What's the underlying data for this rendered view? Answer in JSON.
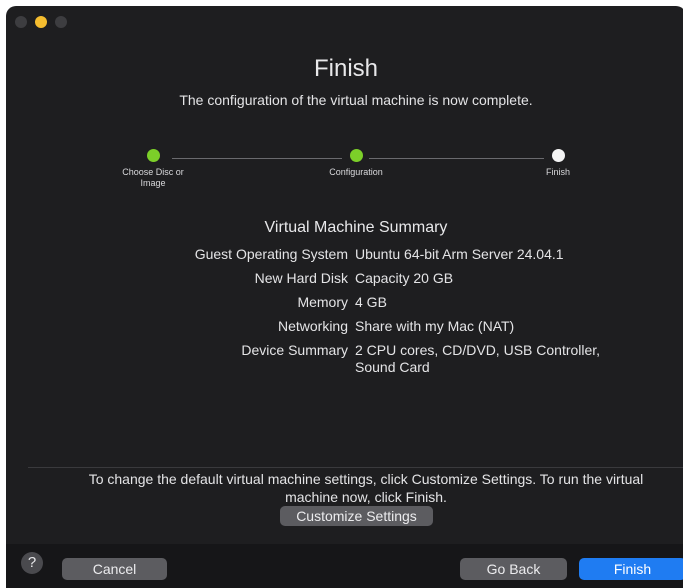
{
  "window": {
    "title": "Finish",
    "subtitle": "The configuration of the virtual machine is now complete."
  },
  "steps": [
    {
      "label": "Choose Disc or Image",
      "state": "done"
    },
    {
      "label": "Configuration",
      "state": "done"
    },
    {
      "label": "Finish",
      "state": "current"
    }
  ],
  "summary": {
    "title": "Virtual Machine Summary",
    "rows": [
      {
        "label": "Guest Operating System",
        "value": "Ubuntu 64-bit Arm Server 24.04.1"
      },
      {
        "label": "New Hard Disk",
        "value": "Capacity 20 GB"
      },
      {
        "label": "Memory",
        "value": "4 GB"
      },
      {
        "label": "Networking",
        "value": "Share with my Mac (NAT)"
      },
      {
        "label": "Device Summary",
        "value": "2 CPU cores, CD/DVD, USB Controller, Sound Card"
      }
    ]
  },
  "footer": {
    "note": "To change the default virtual machine settings, click Customize Settings. To run the virtual machine now, click Finish.",
    "customize_label": "Customize Settings"
  },
  "buttons": {
    "help": "?",
    "cancel": "Cancel",
    "go_back": "Go Back",
    "finish": "Finish"
  },
  "colors": {
    "step_done": "#7ccf29",
    "step_current": "#f4f4f4",
    "primary_button": "#1f7cf2",
    "window_bg": "#1e1e20"
  }
}
